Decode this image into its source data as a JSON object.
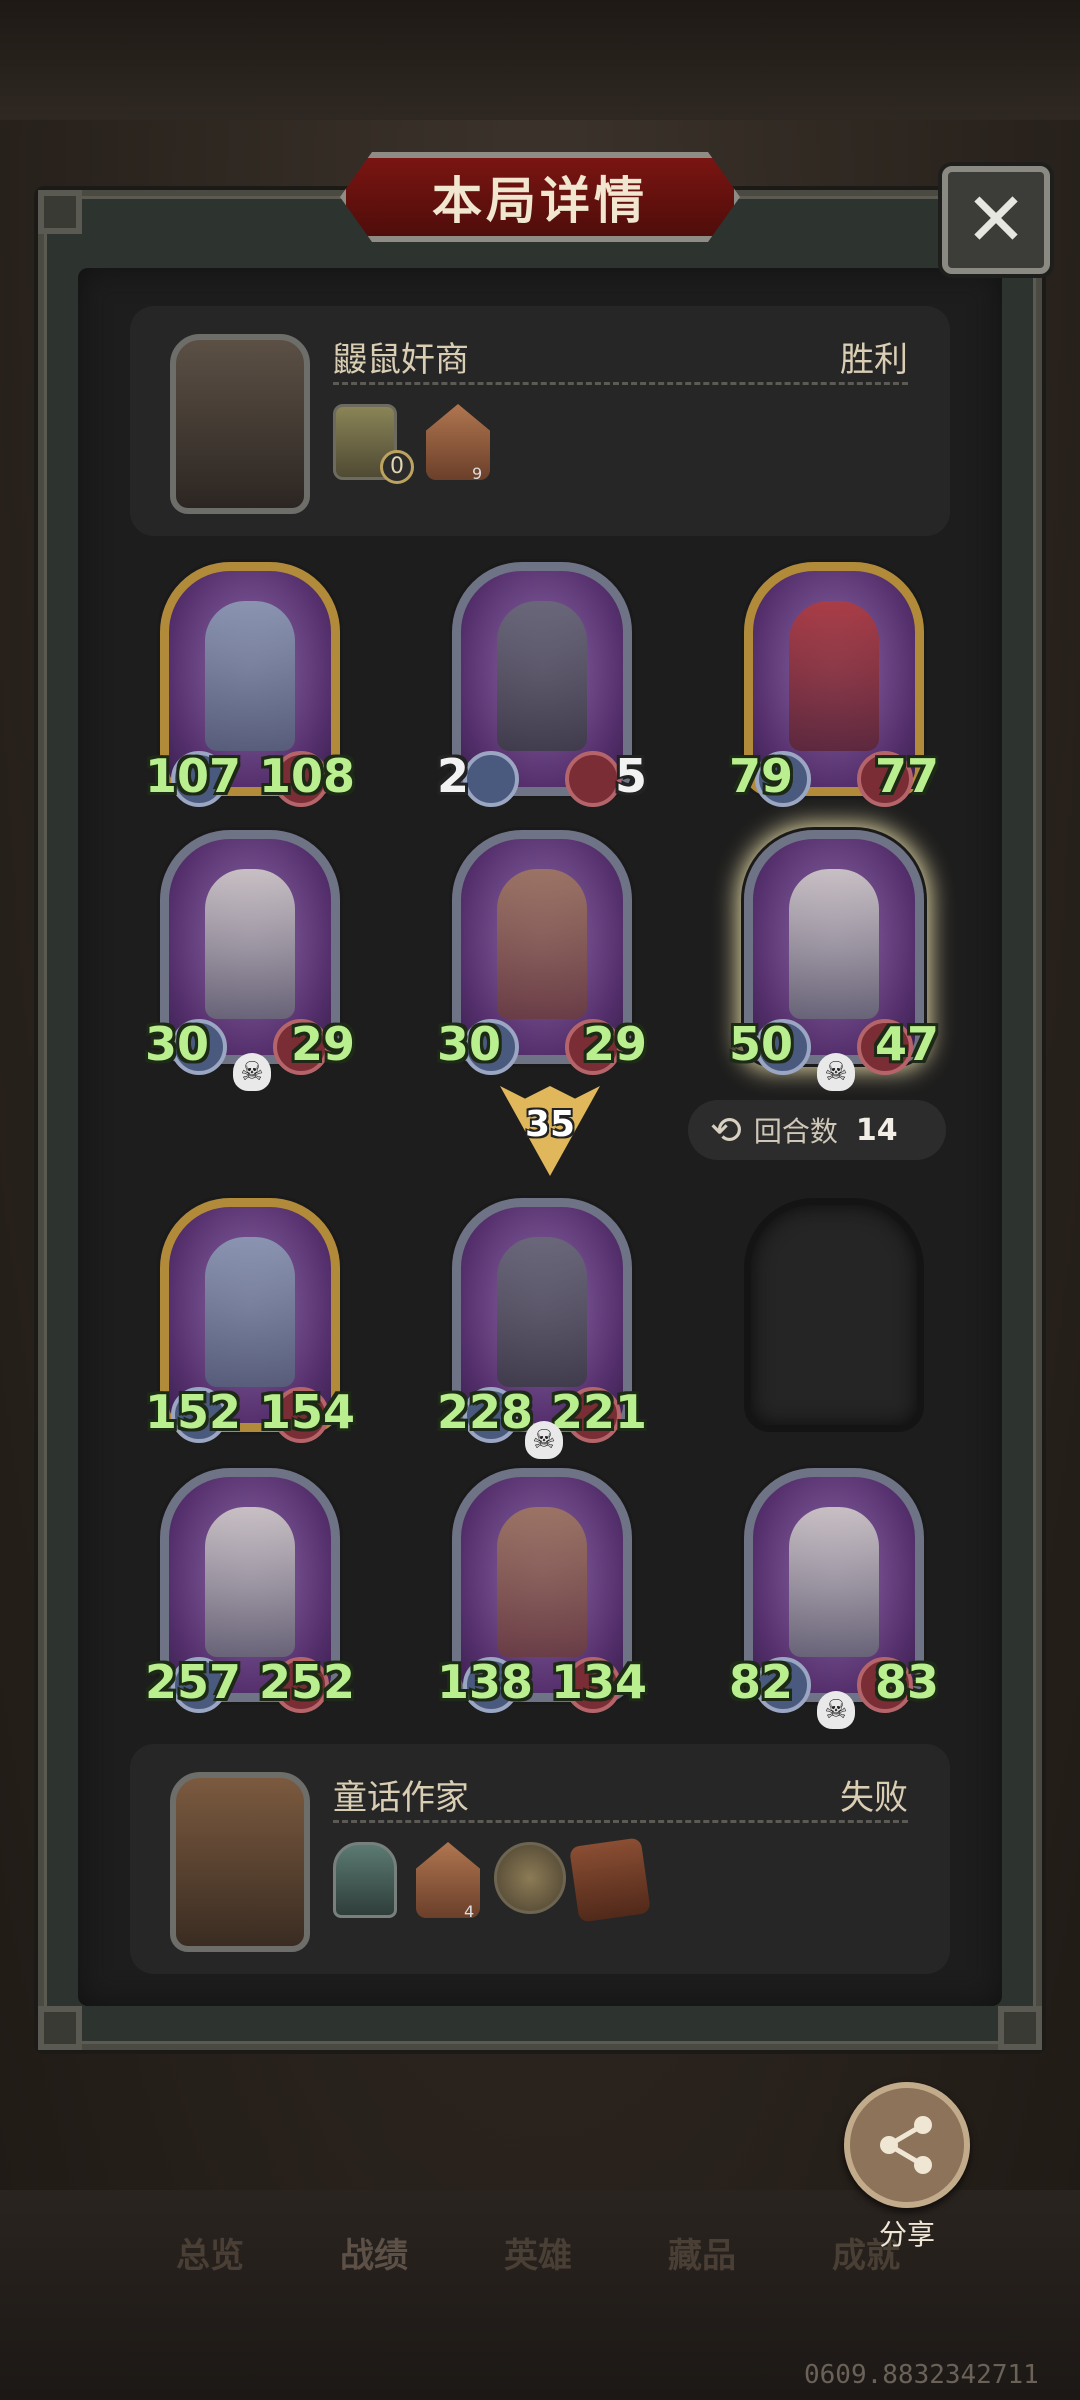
{
  "dialog": {
    "title": "本局详情",
    "close_icon": "close-icon"
  },
  "players": [
    {
      "name": "鼹鼠奸商",
      "result": "胜利",
      "items": [
        {
          "icon": "relic-icon",
          "count": "0"
        },
        {
          "icon": "house-icon",
          "count": "9"
        }
      ]
    },
    {
      "name": "童话作家",
      "result": "失败",
      "items": [
        {
          "icon": "hero-token-icon",
          "count": ""
        },
        {
          "icon": "house-icon",
          "count": "4"
        },
        {
          "icon": "coin-icon",
          "count": ""
        },
        {
          "icon": "book-icon",
          "count": ""
        }
      ]
    }
  ],
  "board_top": [
    {
      "atk": "107",
      "hp": "108",
      "frame": "gold",
      "skull": false
    },
    {
      "atk": "2",
      "hp": "5",
      "frame": "silver",
      "skull": false
    },
    {
      "atk": "79",
      "hp": "77",
      "frame": "gold",
      "skull": false
    },
    {
      "atk": "30",
      "hp": "29",
      "frame": "silver",
      "skull": true
    },
    {
      "atk": "30",
      "hp": "29",
      "frame": "silver",
      "skull": false
    },
    {
      "atk": "50",
      "hp": "47",
      "frame": "silver",
      "skull": true
    }
  ],
  "tier": "35",
  "rounds": {
    "label": "回合数",
    "value": "14"
  },
  "board_bottom": [
    {
      "atk": "152",
      "hp": "154",
      "frame": "gold",
      "skull": false
    },
    {
      "atk": "228",
      "hp": "221",
      "frame": "silver",
      "skull": true
    },
    {
      "atk": "",
      "hp": "",
      "frame": "empty",
      "skull": false
    },
    {
      "atk": "257",
      "hp": "252",
      "frame": "silver",
      "skull": false
    },
    {
      "atk": "138",
      "hp": "134",
      "frame": "silver",
      "skull": false
    },
    {
      "atk": "82",
      "hp": "83",
      "frame": "silver",
      "skull": true
    }
  ],
  "share": {
    "label": "分享"
  },
  "nav": {
    "tabs": [
      "总览",
      "战绩",
      "英雄",
      "藏品",
      "成就"
    ],
    "active": "战绩"
  },
  "watermark": "0609.8832342711"
}
